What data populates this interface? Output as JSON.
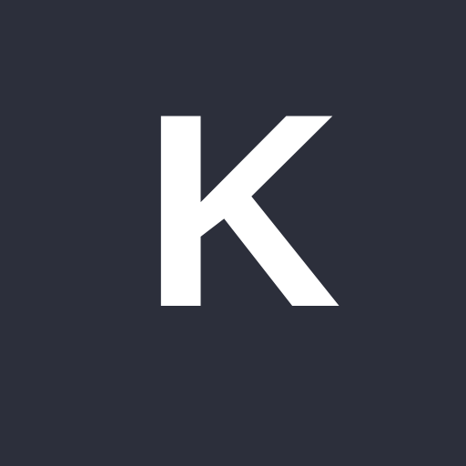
{
  "avatar": {
    "initial": "K",
    "background_color": "#2c2f3b",
    "text_color": "#ffffff"
  }
}
